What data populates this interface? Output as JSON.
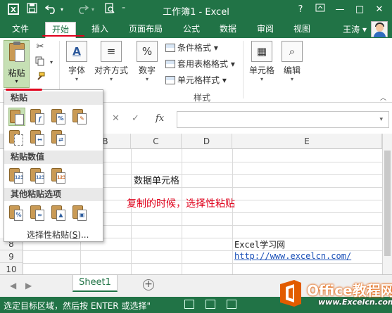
{
  "titlebar": {
    "title": "工作簿1 - Excel",
    "help": "?",
    "minimize": "—",
    "restore": "□",
    "close": "✕"
  },
  "tabs": {
    "file": "文件",
    "home": "开始",
    "insert": "插入",
    "page_layout": "页面布局",
    "formulas": "公式",
    "data": "数据",
    "review": "审阅",
    "view": "视图",
    "user": "王涛"
  },
  "ribbon": {
    "paste": "粘贴",
    "font": "字体",
    "alignment": "对齐方式",
    "number": "数字",
    "cond_format": "条件格式",
    "table_format": "套用表格格式",
    "cell_styles": "单元格样式",
    "styles_group": "样式",
    "cells": "单元格",
    "editing": "编辑",
    "number_icon": "%"
  },
  "dropdown": {
    "paste_header": "粘贴",
    "values_header": "粘贴数值",
    "other_header": "其他粘贴选项",
    "paste_special_prefix": "选择性粘贴(",
    "paste_special_key": "S",
    "paste_special_suffix": ")...",
    "value_badge": "123",
    "percent_badge": "%"
  },
  "formula_bar": {
    "cancel": "✕",
    "enter": "✓",
    "fx": "fx"
  },
  "grid": {
    "columns": [
      "B",
      "C",
      "D",
      "E"
    ],
    "rows": [
      "8",
      "9",
      "10"
    ],
    "cells": {
      "c4": "数据单元格",
      "e8": "Excel学习网",
      "e9": "http://www.excelcn.com/"
    },
    "annotation": "复制的时候，选择性粘贴"
  },
  "sheet": {
    "tab": "Sheet1",
    "add": "+"
  },
  "status": {
    "message": "选定目标区域，然后按 ENTER 或选择\""
  },
  "watermark": {
    "name": "Office教程网",
    "url": "www.Excelcn.com"
  },
  "colors": {
    "accent": "#217346",
    "annotation": "#e0001b",
    "link": "#1a50b8"
  }
}
